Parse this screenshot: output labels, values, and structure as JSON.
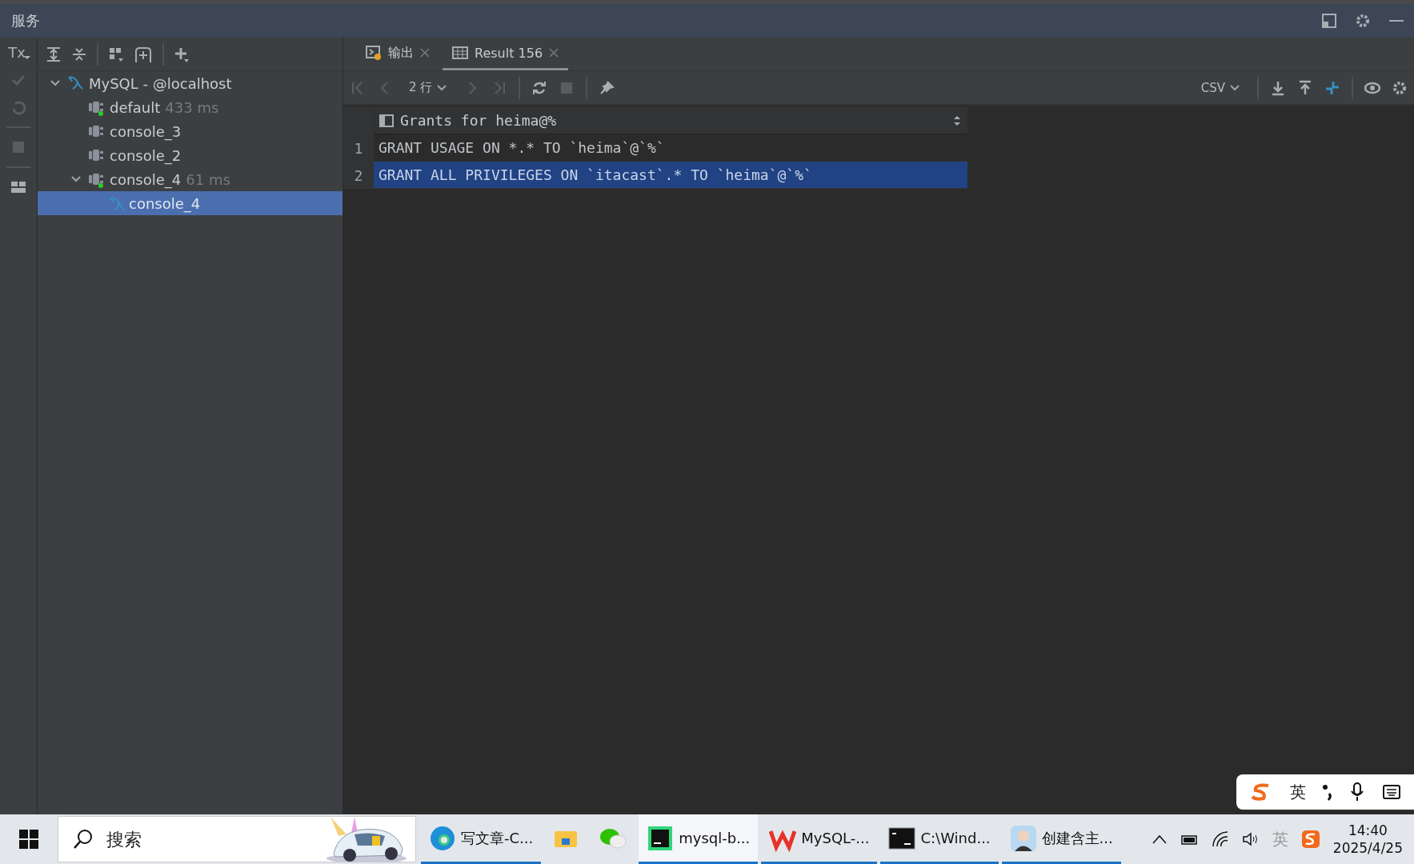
{
  "panel": {
    "title": "服务"
  },
  "side_toolbar": {
    "tx_label": "Tx"
  },
  "tree": [
    {
      "label": "MySQL - @localhost",
      "kind": "datasource",
      "expanded": true,
      "selected": false,
      "children": [
        {
          "label": "default",
          "time": "433 ms",
          "kind": "session",
          "connected": true,
          "selected": false
        },
        {
          "label": "console_3",
          "kind": "session",
          "connected": false,
          "selected": false
        },
        {
          "label": "console_2",
          "kind": "session",
          "connected": false,
          "selected": false
        },
        {
          "label": "console_4",
          "time": "61 ms",
          "kind": "session",
          "connected": true,
          "expanded": true,
          "selected": false,
          "children": [
            {
              "label": "console_4",
              "kind": "console",
              "selected": true
            }
          ]
        }
      ]
    }
  ],
  "tabs": [
    {
      "label": "输出",
      "kind": "output",
      "selected": false
    },
    {
      "label": "Result 156",
      "kind": "table",
      "selected": true
    }
  ],
  "result_toolbar": {
    "page_size": "2 行",
    "format": "CSV"
  },
  "grid": {
    "column": "Grants for heima@%",
    "rows": [
      {
        "number": "1",
        "value": "GRANT USAGE ON *.* TO `heima`@`%`",
        "selected": false
      },
      {
        "number": "2",
        "value": "GRANT ALL PRIVILEGES ON `itacast`.* TO `heima`@`%`",
        "selected": true
      }
    ]
  },
  "ime_bar": {
    "mode": "英"
  },
  "taskbar": {
    "search_placeholder": "搜索",
    "apps": [
      {
        "kind": "edge",
        "label": "写文章-C...",
        "running": true,
        "selected": false
      },
      {
        "kind": "folder",
        "running": false,
        "selected": false
      },
      {
        "kind": "chat",
        "running": false,
        "selected": false
      },
      {
        "kind": "datagrip",
        "label": "mysql-b...",
        "running": true,
        "selected": true
      },
      {
        "kind": "wps",
        "label": "MySQL-...",
        "running": true,
        "selected": false
      },
      {
        "kind": "terminal",
        "label": "C:\\Wind...",
        "running": true,
        "selected": false
      },
      {
        "kind": "avatar",
        "label": "创建含主...",
        "running": true,
        "selected": false
      }
    ],
    "tray_ime": "英",
    "time": "14:40",
    "date": "2025/4/25"
  }
}
